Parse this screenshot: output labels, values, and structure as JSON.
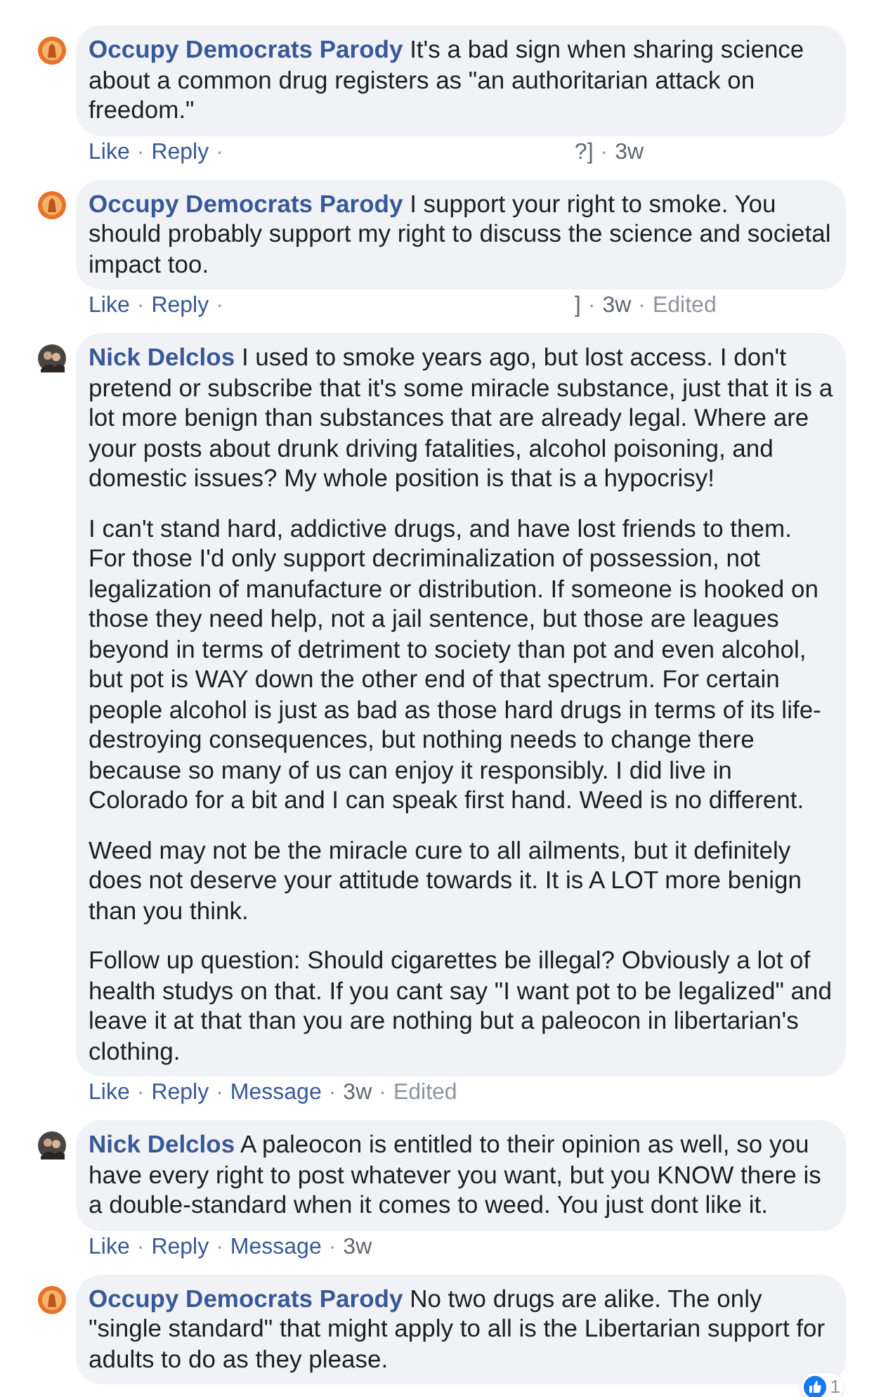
{
  "comments": [
    {
      "author": "Occupy Democrats Parody",
      "avatar": {
        "kind": "logo"
      },
      "paragraphs": [
        "It's a bad sign when sharing science about a common drug registers as \"an authoritarian attack on freedom.\""
      ],
      "separator": "·",
      "actions": [
        {
          "kind": "link",
          "text": "Like"
        },
        {
          "kind": "link",
          "text": "Reply"
        },
        {
          "kind": "gap"
        },
        {
          "kind": "meta",
          "text": "?]"
        },
        {
          "kind": "meta",
          "text": "3w"
        }
      ]
    },
    {
      "author": "Occupy Democrats Parody",
      "avatar": {
        "kind": "logo"
      },
      "paragraphs": [
        "I support your right to smoke. You should probably support my right to discuss the science and societal impact too."
      ],
      "separator": "·",
      "actions": [
        {
          "kind": "link",
          "text": "Like"
        },
        {
          "kind": "link",
          "text": "Reply"
        },
        {
          "kind": "gap"
        },
        {
          "kind": "meta",
          "text": "]"
        },
        {
          "kind": "meta",
          "text": "3w"
        },
        {
          "kind": "edited",
          "text": "Edited"
        }
      ]
    },
    {
      "author": "Nick Delclos",
      "avatar": {
        "kind": "photo"
      },
      "paragraphs": [
        "I used to smoke years ago, but lost access. I don't pretend or subscribe that it's some miracle substance, just that it is a lot more benign than substances that are already legal. Where are your posts about drunk driving fatalities, alcohol poisoning, and domestic issues? My whole position is that is a hypocrisy!",
        "I can't stand hard, addictive drugs, and have lost friends to them. For those I'd only support decriminalization of possession, not legalization of manufacture or distribution. If someone is hooked on those they need help, not a jail sentence, but those are leagues beyond in terms of detriment to society than pot and even alcohol, but pot is WAY down the other end of that spectrum. For certain people alcohol is just as bad as those hard drugs in terms of its life-destroying consequences, but nothing needs to change there because so many of us can enjoy it responsibly. I did live in Colorado for a bit and I can speak first hand. Weed is no different.",
        "Weed may not be the miracle cure to all ailments, but it definitely does not deserve your attitude towards it. It is A LOT more benign than you think.",
        "Follow up question: Should cigarettes be illegal? Obviously a lot of health studys on that. If you cant say \"I want pot to be legalized\" and leave it at that than you are nothing but a paleocon in libertarian's clothing."
      ],
      "separator": "·",
      "actions": [
        {
          "kind": "link",
          "text": "Like"
        },
        {
          "kind": "link",
          "text": "Reply"
        },
        {
          "kind": "link",
          "text": "Message"
        },
        {
          "kind": "meta",
          "text": "3w"
        },
        {
          "kind": "edited",
          "text": "Edited"
        }
      ]
    },
    {
      "author": "Nick Delclos",
      "avatar": {
        "kind": "photo"
      },
      "paragraphs": [
        "A paleocon is entitled to their opinion as well, so you have every right to post whatever you want, but you KNOW there is a double-standard when it comes to weed. You just dont like it."
      ],
      "separator": "·",
      "actions": [
        {
          "kind": "link",
          "text": "Like"
        },
        {
          "kind": "link",
          "text": "Reply"
        },
        {
          "kind": "link",
          "text": "Message"
        },
        {
          "kind": "meta",
          "text": "3w"
        }
      ]
    },
    {
      "author": "Occupy Democrats Parody",
      "avatar": {
        "kind": "logo"
      },
      "paragraphs": [
        "No two drugs are alike. The only \"single standard\" that might apply to all is the Libertarian support for adults to do as they please."
      ],
      "reactions": {
        "count": "1"
      }
    }
  ]
}
